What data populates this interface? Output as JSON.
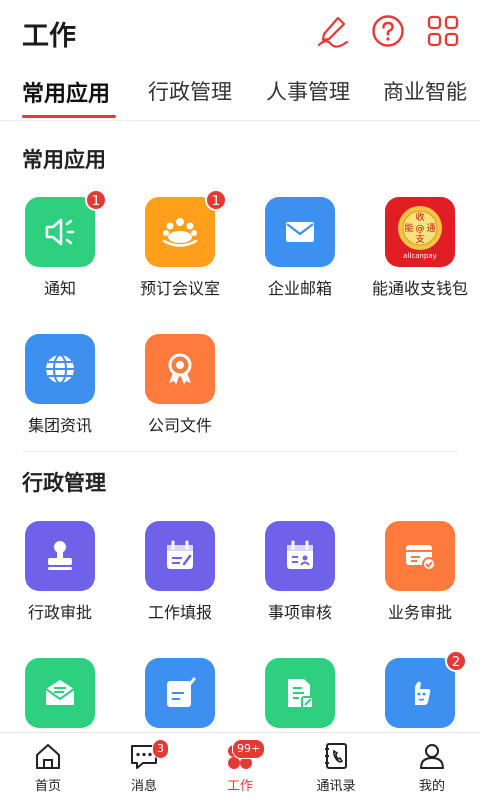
{
  "header": {
    "title": "工作",
    "icons": [
      "signature-icon",
      "help-icon",
      "grid-icon"
    ],
    "accent": "#e53935"
  },
  "tabs": [
    {
      "label": "常用应用",
      "active": true
    },
    {
      "label": "行政管理"
    },
    {
      "label": "人事管理"
    },
    {
      "label": "商业智能"
    }
  ],
  "sections": [
    {
      "title": "常用应用"
    },
    {
      "title": "行政管理"
    }
  ],
  "apps": [
    {
      "label": "通知",
      "badge": "1",
      "color": "#2ecf7f",
      "icon": "speaker-icon"
    },
    {
      "label": "预订会议室",
      "badge": "1",
      "color": "#ff9f1a",
      "icon": "meeting-icon"
    },
    {
      "label": "企业邮箱",
      "color": "#3d8ff0",
      "icon": "mail-icon"
    },
    {
      "label": "能通收支钱包",
      "color": "#e01e24",
      "icon": "allcanpay-logo",
      "logo_text": [
        "收",
        "能",
        "@",
        "通",
        "支",
        "allcanpay"
      ]
    },
    {
      "label": "集团资讯",
      "color": "#3d8ff0",
      "icon": "globe-icon"
    },
    {
      "label": "公司文件",
      "color": "#ff7a3d",
      "icon": "award-icon"
    },
    {
      "label": "行政审批",
      "color": "#6e63e8",
      "icon": "stamp-icon"
    },
    {
      "label": "工作填报",
      "color": "#6e63e8",
      "icon": "calendar-edit-icon"
    },
    {
      "label": "事项审核",
      "color": "#6e63e8",
      "icon": "calendar-check-icon"
    },
    {
      "label": "业务审批",
      "color": "#ff7a3d",
      "icon": "card-check-icon"
    },
    {
      "label": "",
      "color": "#2ecf7f",
      "icon": "mail-open-icon"
    },
    {
      "label": "",
      "color": "#3d8ff0",
      "icon": "note-edit-icon"
    },
    {
      "label": "",
      "color": "#2ecf7f",
      "icon": "document-edit-icon"
    },
    {
      "label": "",
      "badge": "2",
      "color": "#3d8ff0",
      "icon": "thumb-icon"
    }
  ],
  "bottom_nav": [
    {
      "label": "首页",
      "icon": "home-icon"
    },
    {
      "label": "消息",
      "icon": "message-icon",
      "badge": "3"
    },
    {
      "label": "工作",
      "icon": "work-icon",
      "badge": "99+",
      "active": true
    },
    {
      "label": "通讯录",
      "icon": "contacts-icon"
    },
    {
      "label": "我的",
      "icon": "user-icon"
    }
  ]
}
